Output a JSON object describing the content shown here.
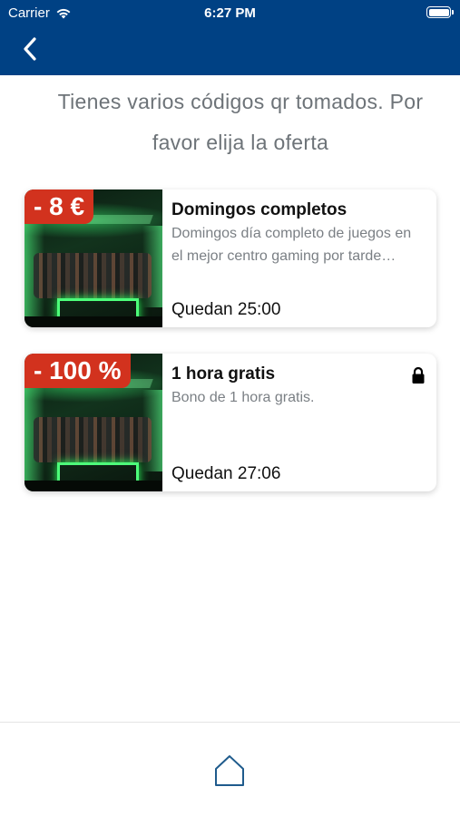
{
  "status_bar": {
    "carrier": "Carrier",
    "time": "6:27 PM"
  },
  "nav": {
    "back_icon": "chevron-left-icon"
  },
  "message": "Tienes varios códigos qr tomados. Por favor elija la oferta",
  "offers": [
    {
      "badge": "- 8 €",
      "title": "Domingos completos",
      "description": "Domingos día completo de juegos en el mejor centro gaming por tarde completa",
      "remaining": "Quedan 25:00",
      "locked": false
    },
    {
      "badge": "- 100 %",
      "title": "1 hora gratis",
      "description": "Bono de 1 hora gratis.",
      "remaining": "Quedan 27:06",
      "locked": true
    }
  ],
  "tab_bar": {
    "home_icon": "home-icon"
  },
  "colors": {
    "header": "#004184",
    "badge": "#d2321e",
    "home_icon": "#1f5b8c"
  }
}
